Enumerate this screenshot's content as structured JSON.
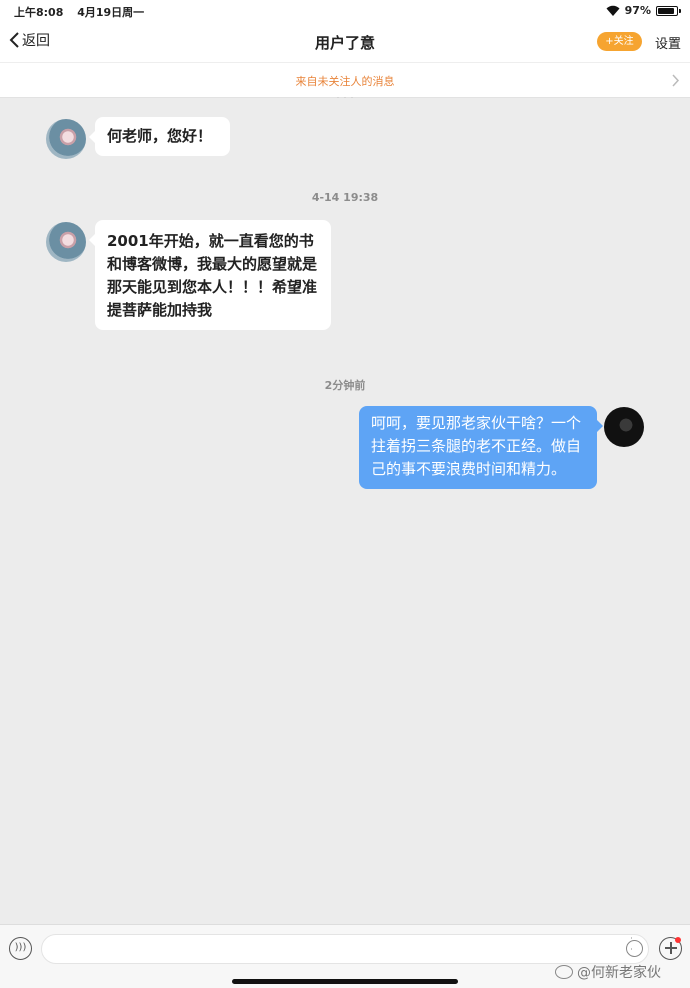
{
  "status_bar": {
    "time": "上午8:08",
    "date": "4月19日周一",
    "battery": "97%"
  },
  "nav": {
    "back_label": "返回",
    "title": "用户了意",
    "follow_label": "+关注",
    "settings_label": "设置"
  },
  "notice": {
    "text": "来自未关注人的消息"
  },
  "messages": [
    {
      "timestamp": "",
      "side": "left",
      "text": "何老师，您好！"
    },
    {
      "timestamp": "4-14 19:38",
      "side": "left",
      "text": "2001年开始，就一直看您的书和博客微博，我最大的愿望就是那天能见到您本人！！！希望准提菩萨能加持我"
    },
    {
      "timestamp": "2分钟前",
      "side": "right",
      "text": "呵呵，要见那老家伙干啥？一个拄着拐三条腿的老不正经。做自己的事不要浪费时间和精力。"
    }
  ],
  "input": {
    "placeholder": ""
  },
  "watermark": {
    "text": "@何新老家伙"
  }
}
